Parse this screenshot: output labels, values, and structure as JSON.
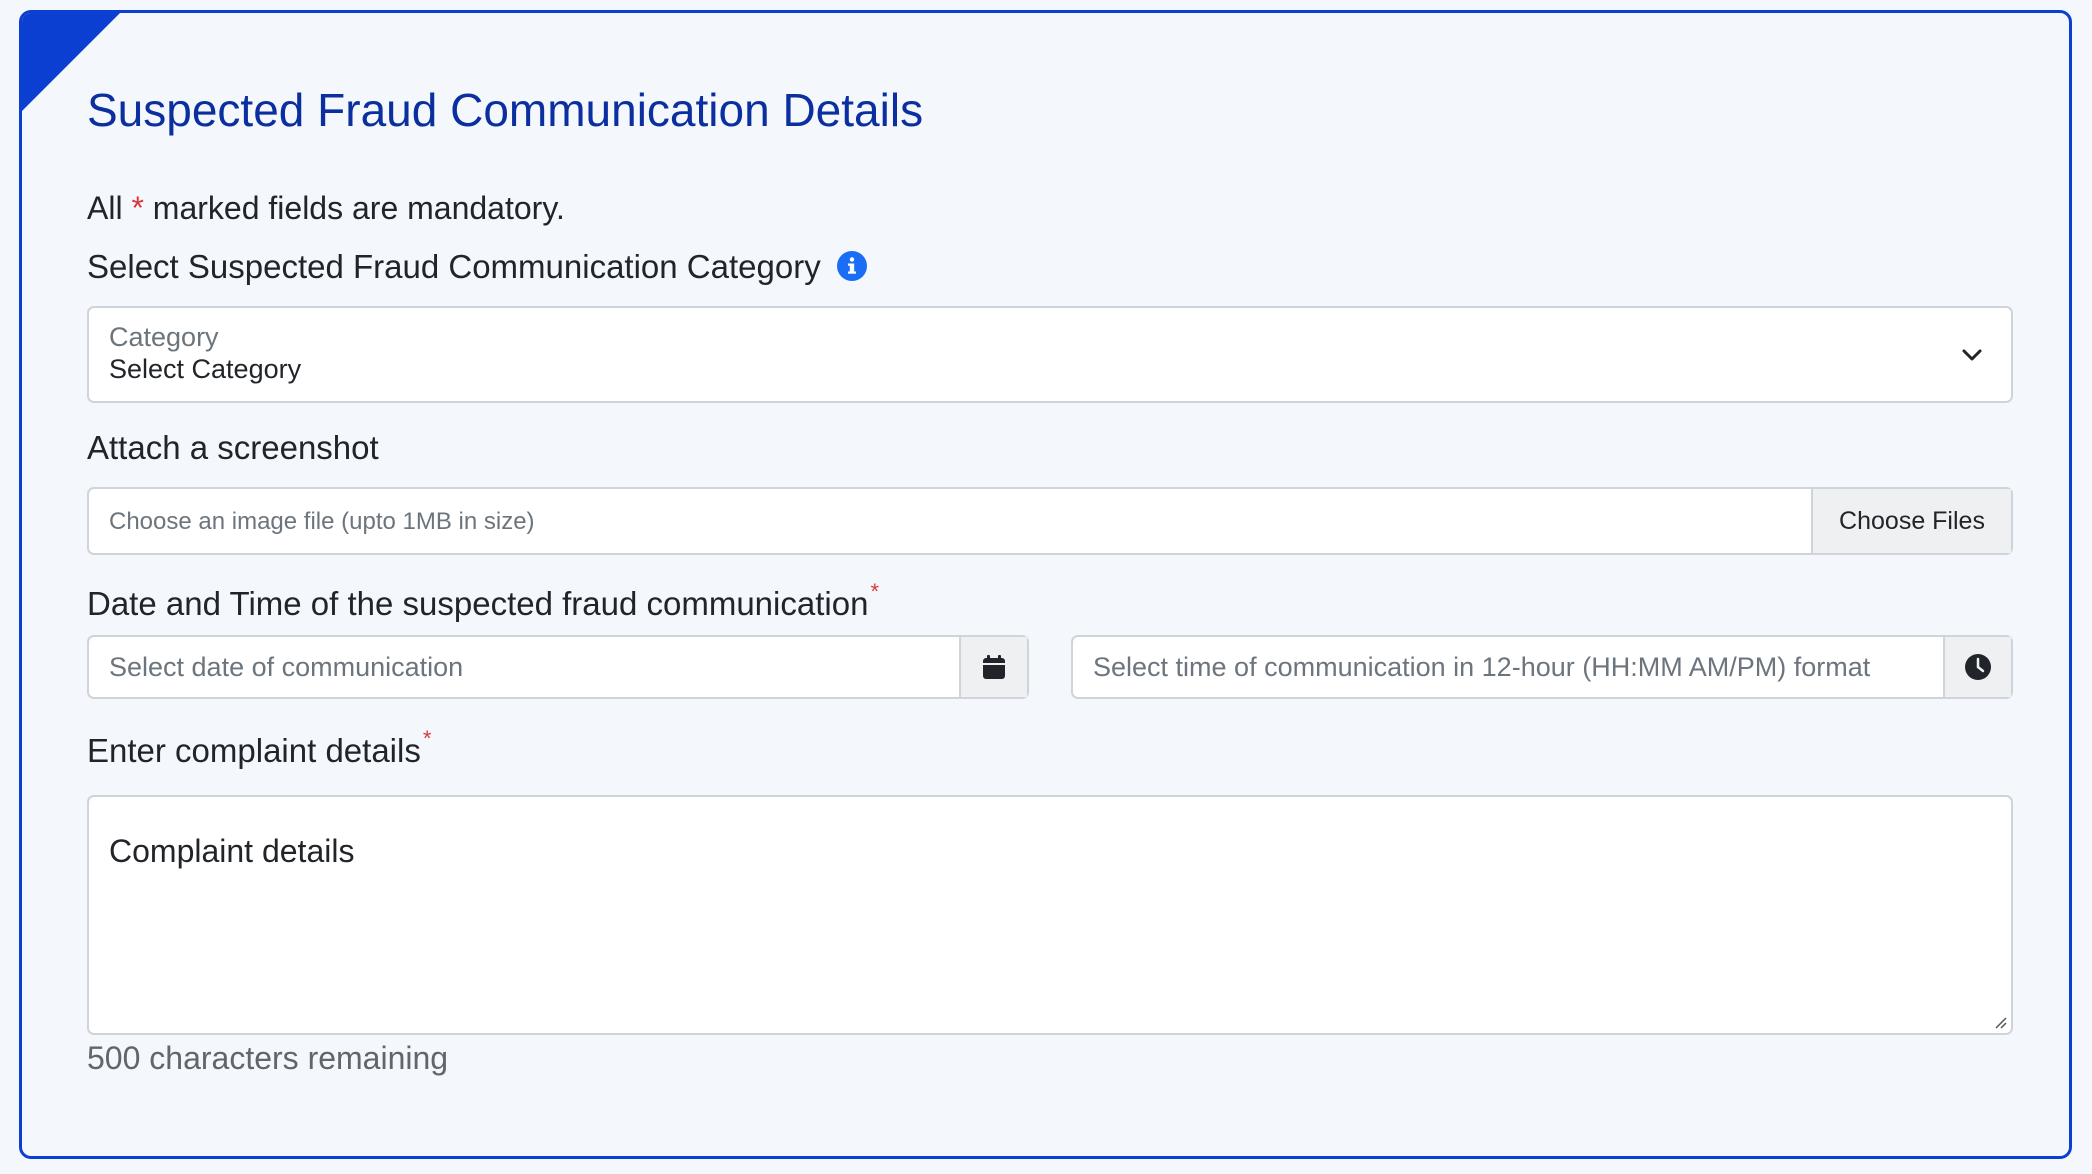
{
  "form": {
    "title": "Suspected Fraud Communication Details",
    "mandatory_prefix": "All",
    "mandatory_star": "*",
    "mandatory_suffix": "marked fields are mandatory.",
    "colors": {
      "accent": "#0b3fd1",
      "title": "#0b2f9e",
      "required": "#d63b3b",
      "info": "#1a6ef5"
    }
  },
  "category": {
    "label": "Select Suspected Fraud Communication Category",
    "info_icon": "info-circle-icon",
    "floating_label": "Category",
    "selected": "Select Category",
    "chevron_icon": "chevron-down-icon"
  },
  "screenshot": {
    "label": "Attach a screenshot",
    "placeholder": "Choose an image file (upto 1MB in size)",
    "button_label": "Choose Files"
  },
  "datetime": {
    "label": "Date and Time of the suspected fraud communication",
    "required_star": "*",
    "date_placeholder": "Select date of communication",
    "date_icon": "calendar-icon",
    "time_placeholder": "Select time of communication in 12-hour (HH:MM AM/PM) format",
    "time_icon": "clock-icon"
  },
  "complaint": {
    "label": "Enter complaint details",
    "required_star": "*",
    "placeholder": "Complaint details",
    "remaining": "500 characters remaining"
  }
}
